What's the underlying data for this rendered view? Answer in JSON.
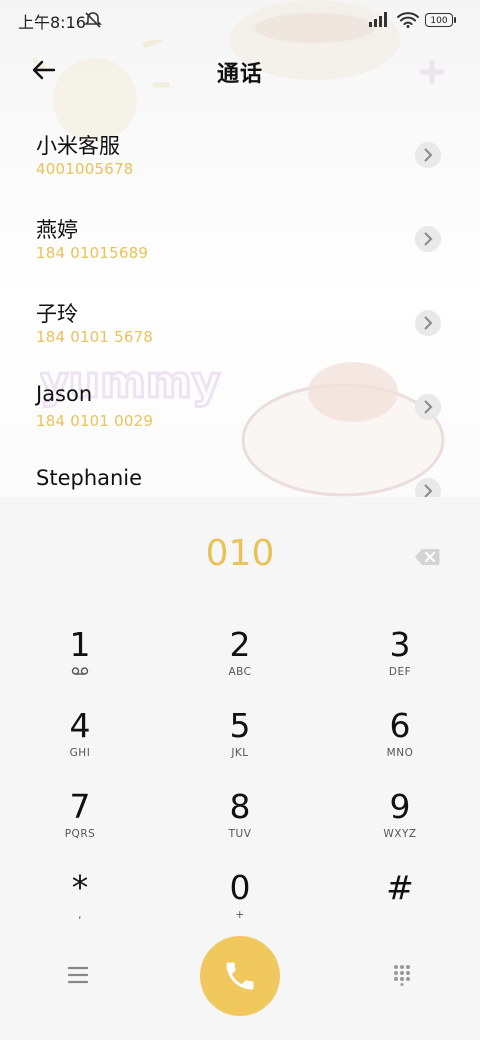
{
  "status": {
    "time": "上午8:16",
    "battery": "100",
    "icons": [
      "mute-icon",
      "signal-icon",
      "wifi-icon",
      "battery-icon"
    ]
  },
  "header": {
    "title": "通话",
    "back_icon": "back-arrow-icon"
  },
  "contacts": [
    {
      "name": "小米客服",
      "number": "4001005678"
    },
    {
      "name": "燕婷",
      "number": "184 01015689"
    },
    {
      "name": "子玲",
      "number": "184 0101 5678"
    },
    {
      "name": "Jason",
      "number": "184 0101 0029"
    },
    {
      "name": "Stephanie",
      "number": ""
    }
  ],
  "dialer": {
    "input": "010",
    "keys": [
      {
        "digit": "1",
        "letters": ""
      },
      {
        "digit": "2",
        "letters": "ABC"
      },
      {
        "digit": "3",
        "letters": "DEF"
      },
      {
        "digit": "4",
        "letters": "GHI"
      },
      {
        "digit": "5",
        "letters": "JKL"
      },
      {
        "digit": "6",
        "letters": "MNO"
      },
      {
        "digit": "7",
        "letters": "PQRS"
      },
      {
        "digit": "8",
        "letters": "TUV"
      },
      {
        "digit": "9",
        "letters": "WXYZ"
      },
      {
        "digit": "*",
        "letters": ","
      },
      {
        "digit": "0",
        "letters": "+"
      },
      {
        "digit": "#",
        "letters": ""
      }
    ]
  },
  "colors": {
    "accent": "#e8c25a",
    "call_button": "#f0c85e"
  }
}
